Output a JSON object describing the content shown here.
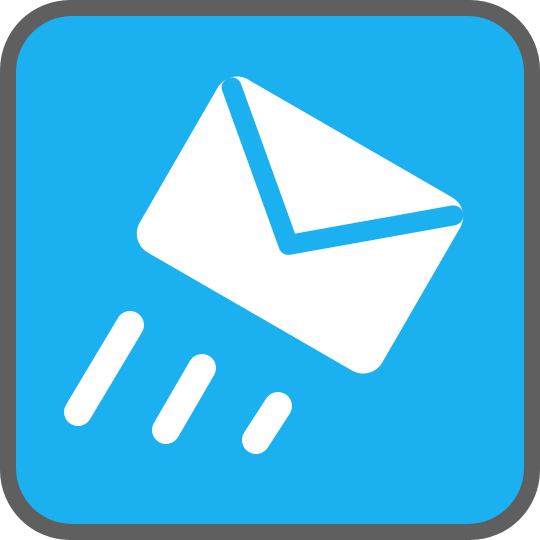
{
  "icon": {
    "name": "send-mail-icon",
    "colors": {
      "frame": "#5f5f5f",
      "background": "#1bb0f0",
      "glyph": "#ffffff"
    }
  }
}
